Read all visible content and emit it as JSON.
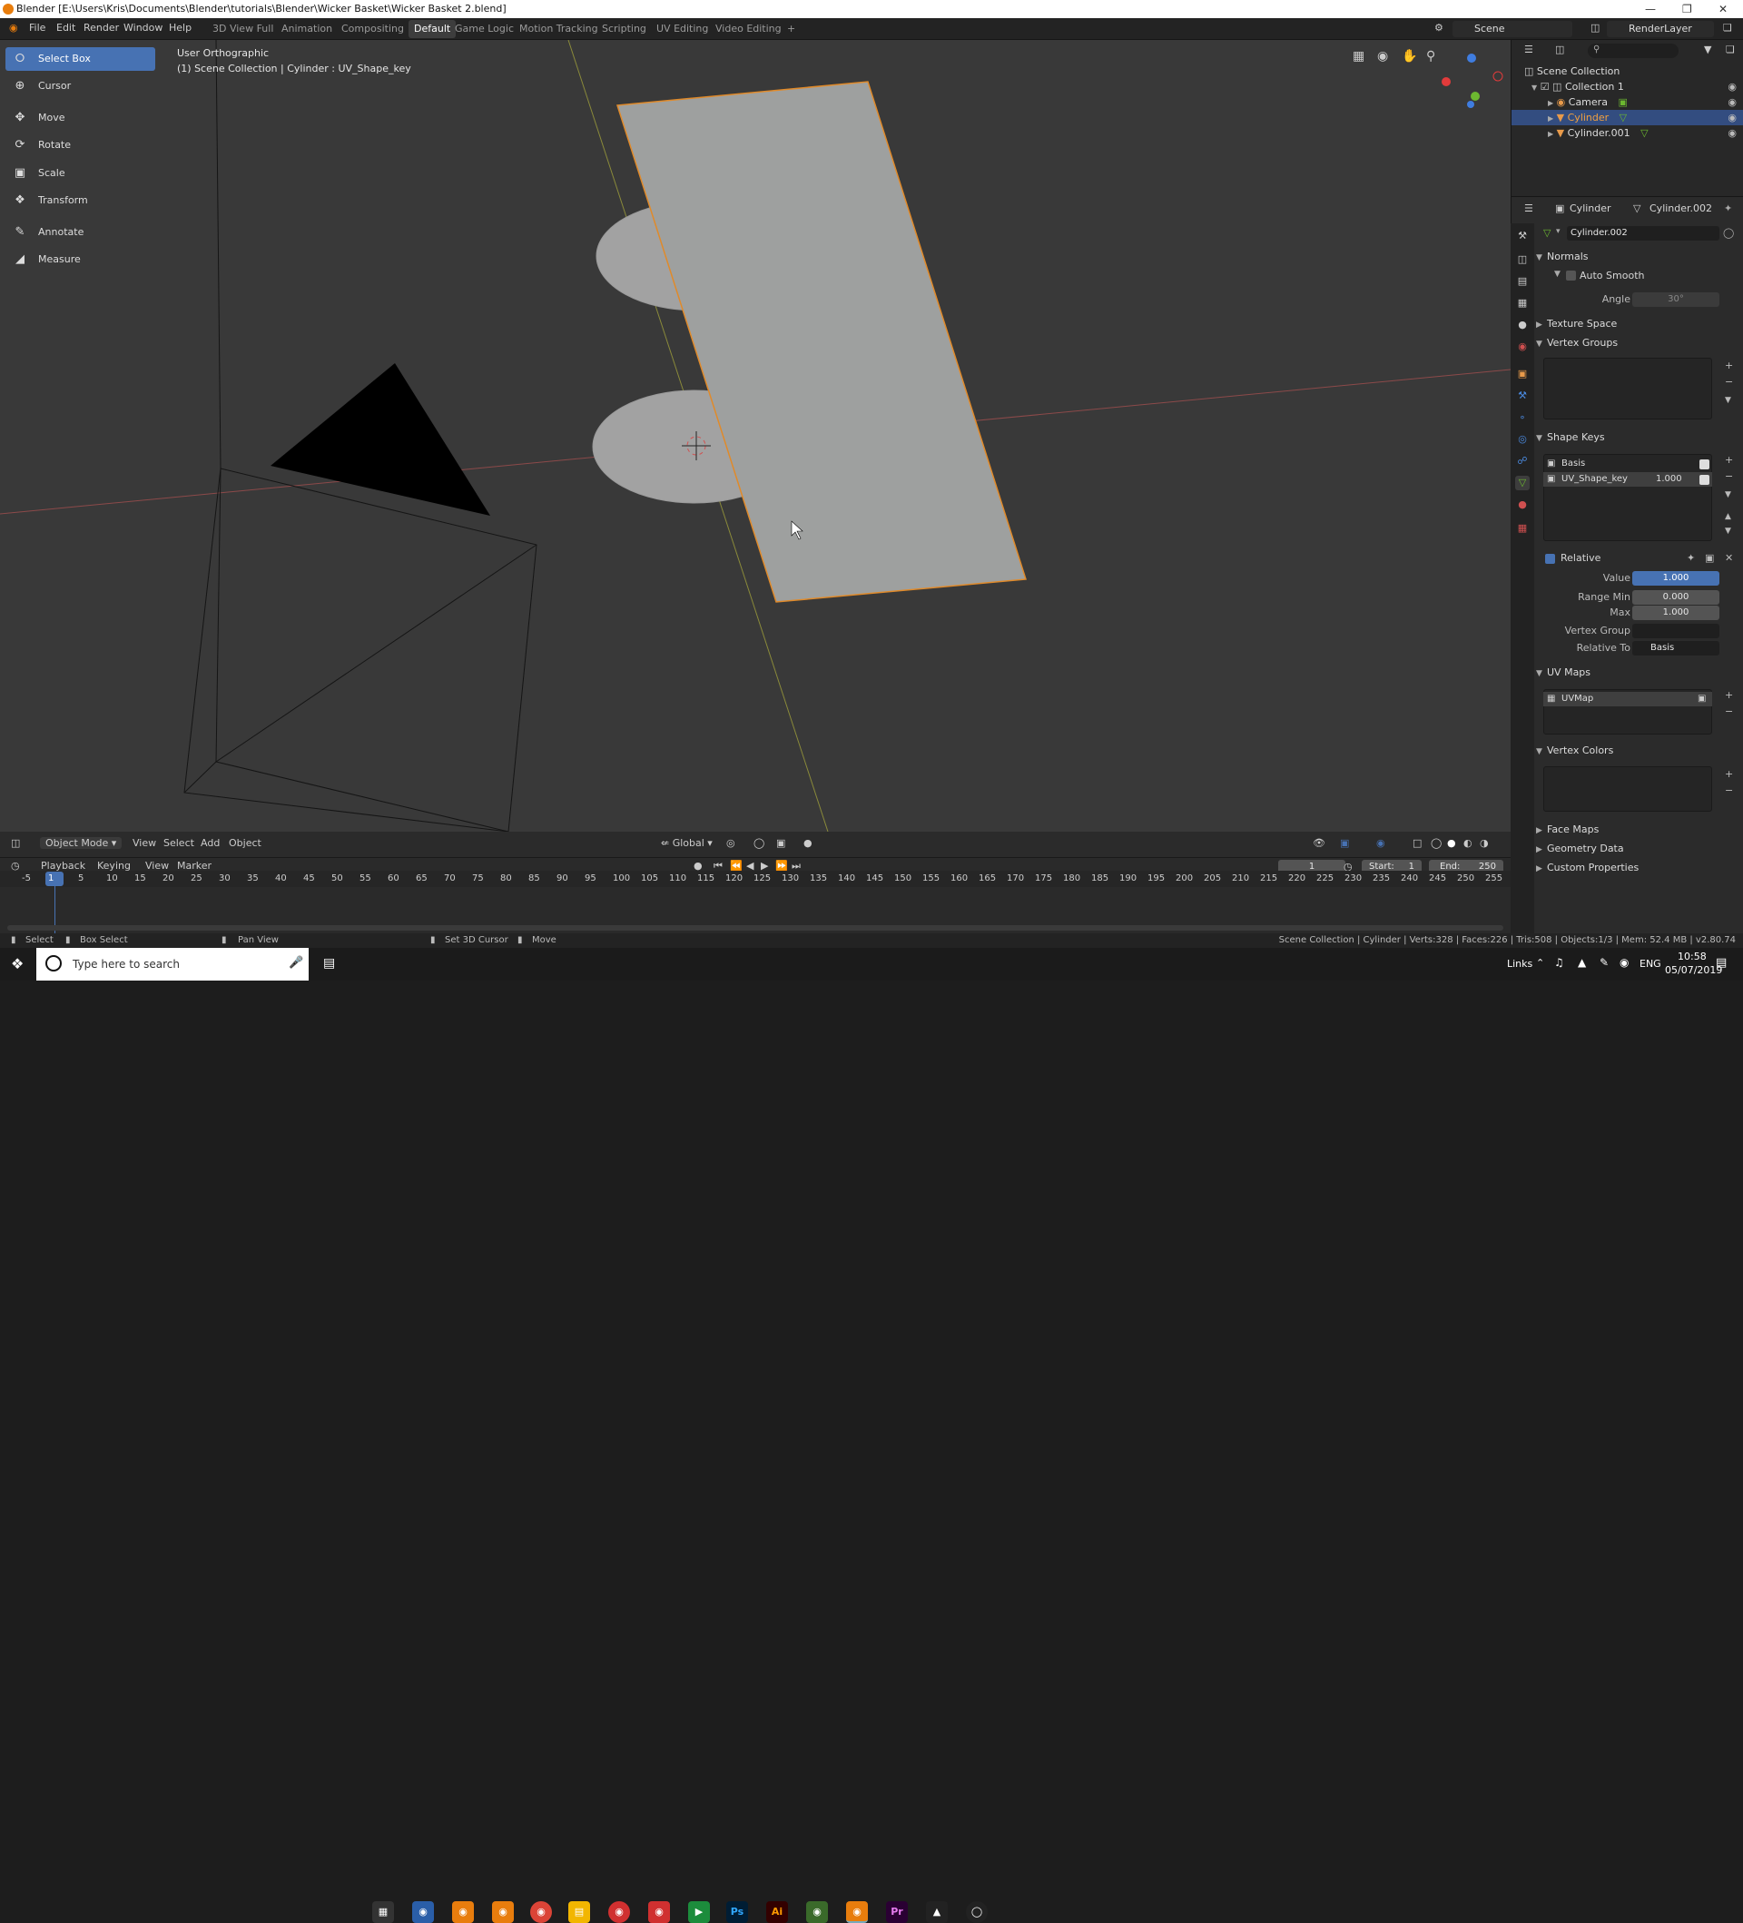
{
  "window": {
    "title": "Blender [E:\\Users\\Kris\\Documents\\Blender\\tutorials\\Blender\\Wicker Basket\\Wicker Basket 2.blend]"
  },
  "menu": [
    "File",
    "Edit",
    "Render",
    "Window",
    "Help"
  ],
  "workspaces": [
    "3D View Full",
    "Animation",
    "Compositing",
    "Default",
    "Game Logic",
    "Motion Tracking",
    "Scripting",
    "UV Editing",
    "Video Editing",
    "+"
  ],
  "active_workspace": "Default",
  "scene": {
    "name": "Scene",
    "render_layer": "RenderLayer"
  },
  "viewport": {
    "view_name": "User Orthographic",
    "collection_info": "(1) Scene Collection | Cylinder : UV_Shape_key"
  },
  "tools": [
    "Select Box",
    "Cursor",
    "Move",
    "Rotate",
    "Scale",
    "Transform",
    "Annotate",
    "Measure"
  ],
  "tool_icons": [
    "select-box-icon",
    "cursor-icon",
    "move-icon",
    "rotate-icon",
    "scale-icon",
    "transform-icon",
    "annotate-icon",
    "measure-icon"
  ],
  "viewport_header": {
    "mode": "Object Mode",
    "menus": [
      "View",
      "Select",
      "Add",
      "Object"
    ],
    "orientation": "Global"
  },
  "timeline": {
    "menus": [
      "Playback",
      "Keying",
      "View",
      "Marker"
    ],
    "current_frame": "1",
    "start_label": "Start:",
    "start": "1",
    "end_label": "End:",
    "end": "250",
    "ticks": [
      "-5",
      "1",
      "5",
      "10",
      "15",
      "20",
      "25",
      "30",
      "35",
      "40",
      "45",
      "50",
      "55",
      "60",
      "65",
      "70",
      "75",
      "80",
      "85",
      "90",
      "95",
      "100",
      "105",
      "110",
      "115",
      "120",
      "125",
      "130",
      "135",
      "140",
      "145",
      "150",
      "155",
      "160",
      "165",
      "170",
      "175",
      "180",
      "185",
      "190",
      "195",
      "200",
      "205",
      "210",
      "215",
      "220",
      "225",
      "230",
      "235",
      "240",
      "245",
      "250",
      "255"
    ]
  },
  "statusbar": {
    "left": [
      "Select",
      "Box Select",
      "Pan View",
      "Set 3D Cursor",
      "Move"
    ],
    "right": "Scene Collection | Cylinder | Verts:328 | Faces:226 | Tris:508 | Objects:1/3 | Mem: 52.4 MB | v2.80.74"
  },
  "outliner": {
    "root": "Scene Collection",
    "collection": "Collection 1",
    "items": [
      "Camera",
      "Cylinder",
      "Cylinder.001"
    ]
  },
  "properties": {
    "object_name": "Cylinder",
    "mesh_name": "Cylinder.002",
    "mesh_field": "Cylinder.002",
    "sections": {
      "normals": "Normals",
      "auto_smooth": "Auto Smooth",
      "angle_label": "Angle",
      "angle": "30°",
      "texture_space": "Texture Space",
      "vertex_groups": "Vertex Groups",
      "shape_keys": "Shape Keys",
      "relative": "Relative",
      "value_label": "Value",
      "value": "1.000",
      "range_min_label": "Range Min",
      "range_min": "0.000",
      "max_label": "Max",
      "max": "1.000",
      "vertex_group_label": "Vertex Group",
      "relative_to_label": "Relative To",
      "relative_to": "Basis",
      "uv_maps": "UV Maps",
      "vertex_colors": "Vertex Colors",
      "face_maps": "Face Maps",
      "geometry_data": "Geometry Data",
      "custom_properties": "Custom Properties"
    },
    "shape_keys": [
      {
        "name": "Basis",
        "value": ""
      },
      {
        "name": "UV_Shape_key",
        "value": "1.000"
      }
    ],
    "uv_maps": [
      "UVMap"
    ]
  },
  "taskbar": {
    "search_placeholder": "Type here to search",
    "links": "Links",
    "lang": "ENG",
    "time": "10:58",
    "date": "05/07/2019"
  }
}
